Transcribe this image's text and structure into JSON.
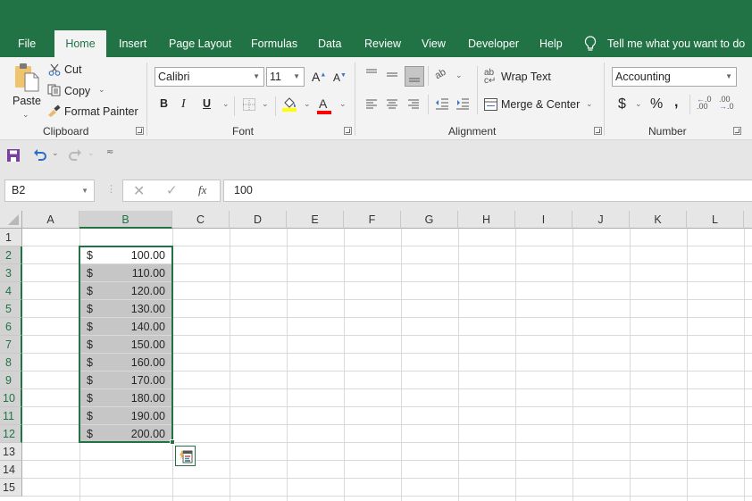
{
  "ribbon_tabs": [
    "File",
    "Home",
    "Insert",
    "Page Layout",
    "Formulas",
    "Data",
    "Review",
    "View",
    "Developer",
    "Help"
  ],
  "active_tab": "Home",
  "tell_me": "Tell me what you want to do",
  "clipboard": {
    "paste": "Paste",
    "cut": "Cut",
    "copy": "Copy",
    "format_painter": "Format Painter",
    "label": "Clipboard"
  },
  "font": {
    "name": "Calibri",
    "size": "11",
    "bold": "B",
    "italic": "I",
    "underline": "U",
    "label": "Font",
    "fill_color": "#ffff00",
    "font_color": "#ff0000"
  },
  "alignment": {
    "wrap_text": "Wrap Text",
    "merge_center": "Merge & Center",
    "label": "Alignment"
  },
  "number": {
    "format": "Accounting",
    "currency": "$",
    "percent": "%",
    "comma": ",",
    "label": "Number"
  },
  "formula_bar": {
    "name_box": "B2",
    "fx": "fx",
    "value": "100"
  },
  "columns": [
    "A",
    "B",
    "C",
    "D",
    "E",
    "F",
    "G",
    "H",
    "I",
    "J",
    "K",
    "L"
  ],
  "rows": [
    "1",
    "2",
    "3",
    "4",
    "5",
    "6",
    "7",
    "8",
    "9",
    "10",
    "11",
    "12",
    "13",
    "14",
    "15"
  ],
  "selected_column": "B",
  "selected_range": "B2:B12",
  "cells_B": [
    {
      "row": "2",
      "currency": "$",
      "amount": "100.00"
    },
    {
      "row": "3",
      "currency": "$",
      "amount": "110.00"
    },
    {
      "row": "4",
      "currency": "$",
      "amount": "120.00"
    },
    {
      "row": "5",
      "currency": "$",
      "amount": "130.00"
    },
    {
      "row": "6",
      "currency": "$",
      "amount": "140.00"
    },
    {
      "row": "7",
      "currency": "$",
      "amount": "150.00"
    },
    {
      "row": "8",
      "currency": "$",
      "amount": "160.00"
    },
    {
      "row": "9",
      "currency": "$",
      "amount": "170.00"
    },
    {
      "row": "10",
      "currency": "$",
      "amount": "180.00"
    },
    {
      "row": "11",
      "currency": "$",
      "amount": "190.00"
    },
    {
      "row": "12",
      "currency": "$",
      "amount": "200.00"
    }
  ],
  "colors": {
    "brand_green": "#217346",
    "selection_fill": "#c6c6c6"
  }
}
